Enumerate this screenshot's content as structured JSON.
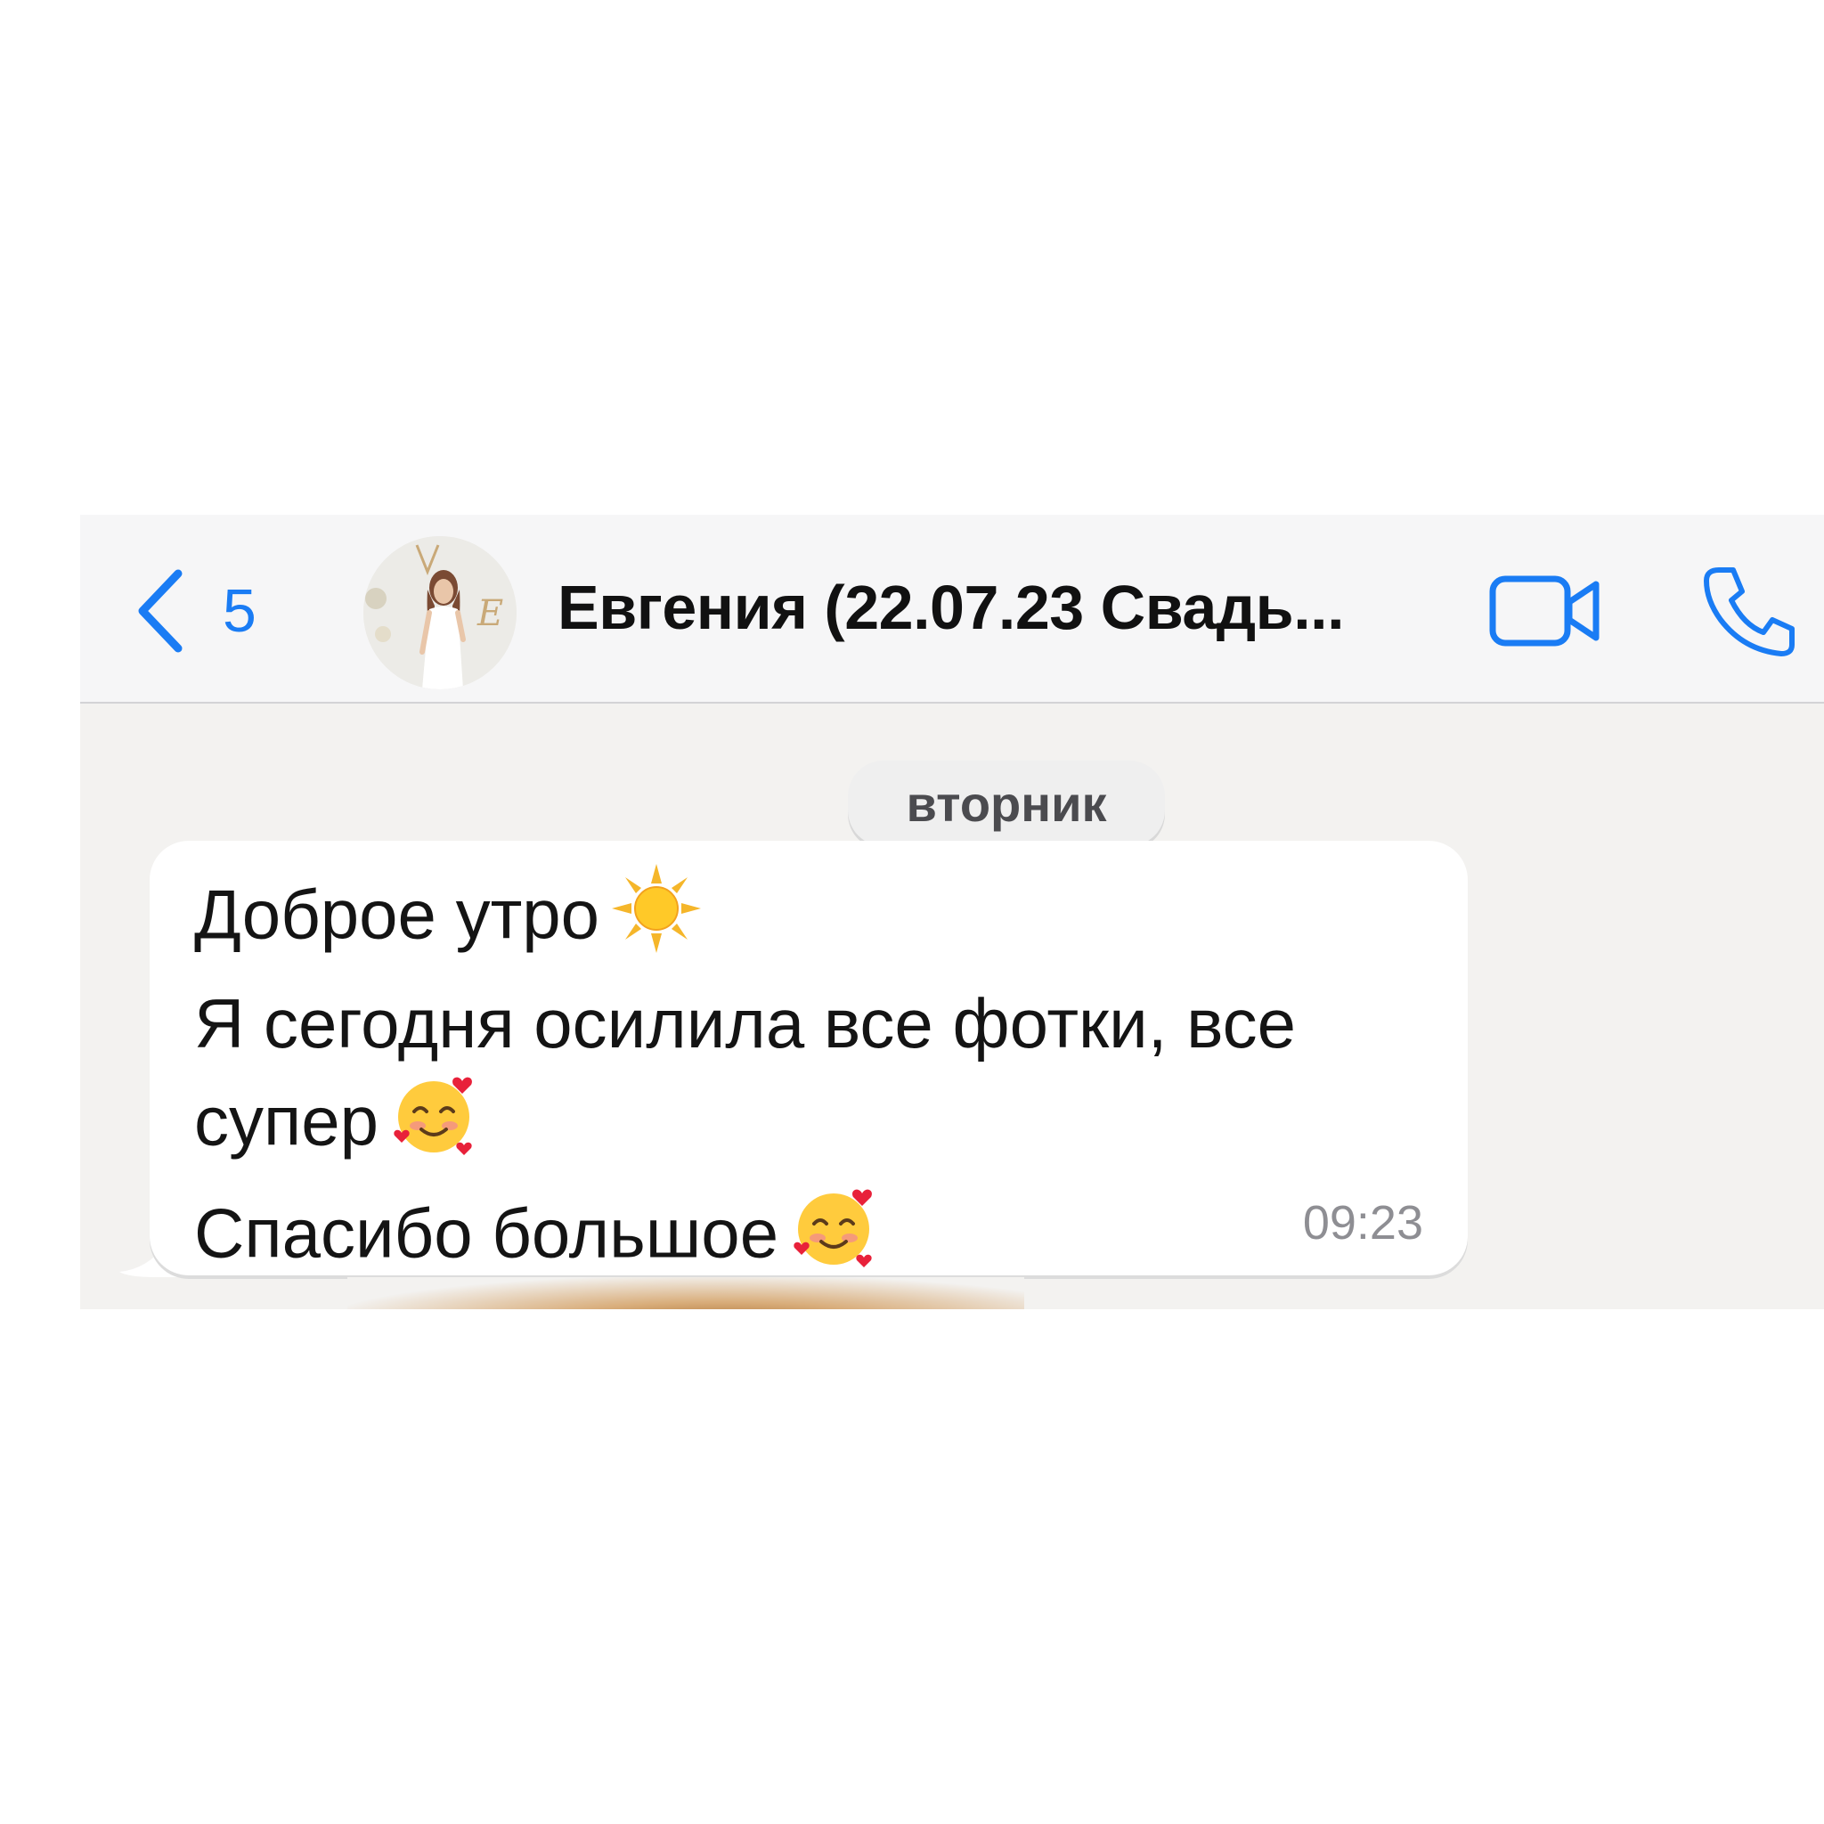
{
  "header": {
    "back_count": "5",
    "contact_name": "Евгения (22.07.23 Свадь...",
    "accent_color": "#1a7cf4",
    "icons": [
      "chevron-left-icon",
      "avatar-photo",
      "video-camera-icon",
      "phone-icon"
    ]
  },
  "chat": {
    "day_label": "вторник",
    "message": {
      "lines": [
        "Доброе утро",
        "Я сегодня осилила все фотки, все",
        "супер",
        "Спасибо большое"
      ],
      "emojis": [
        "sun-emoji",
        "smiling-face-with-hearts-emoji",
        "smiling-face-with-hearts-emoji"
      ],
      "time": "09:23"
    }
  }
}
